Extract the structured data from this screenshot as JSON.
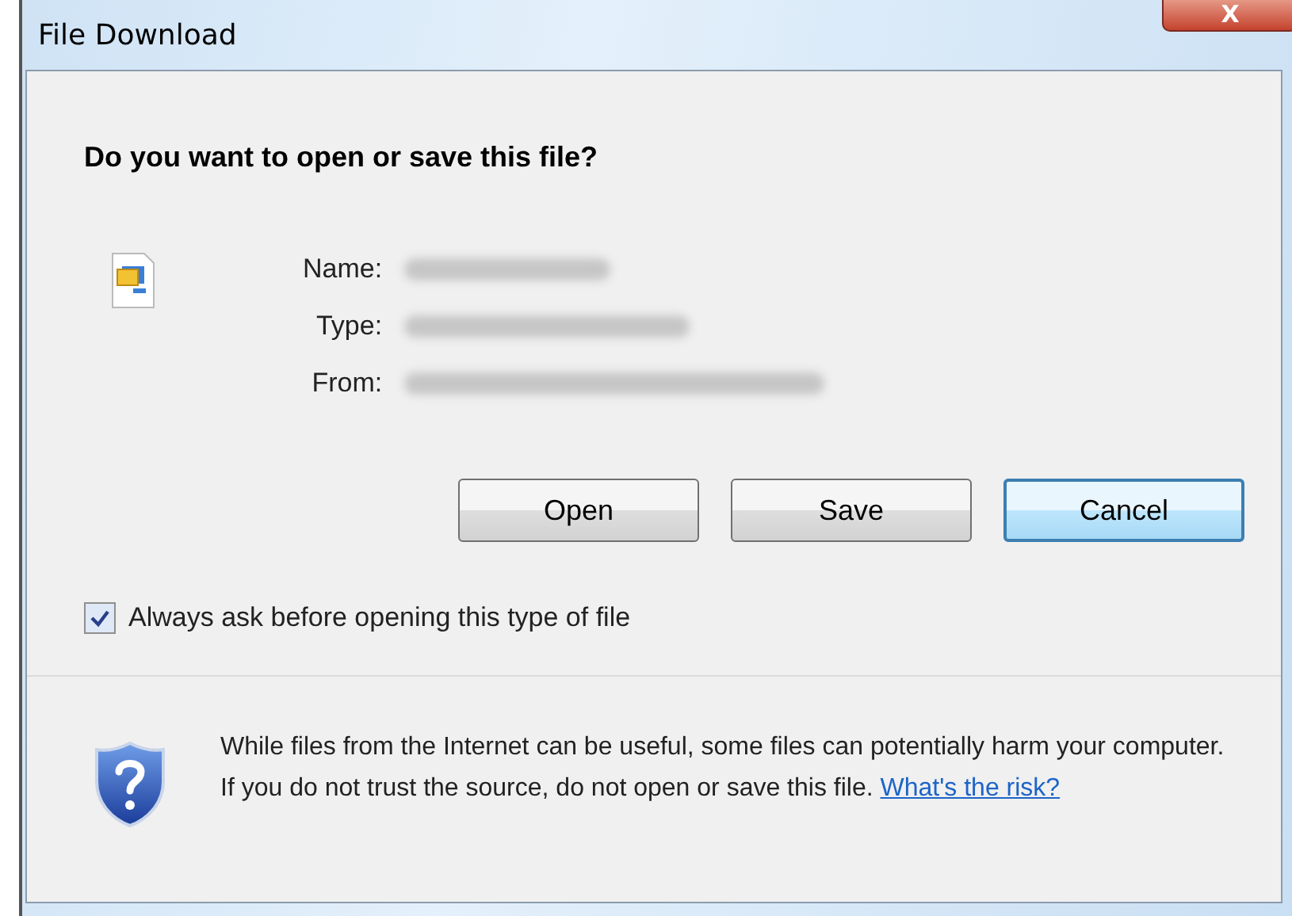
{
  "window": {
    "title": "File Download",
    "close_label": "X"
  },
  "heading": "Do you want to open or save this file?",
  "fields": [
    {
      "label": "Name:"
    },
    {
      "label": "Type:"
    },
    {
      "label": "From:"
    }
  ],
  "buttons": [
    {
      "label": "Open",
      "selected": false
    },
    {
      "label": "Save",
      "selected": false
    },
    {
      "label": "Cancel",
      "selected": true
    }
  ],
  "always_ask": {
    "label": "Always ask before opening this type of file",
    "checked": true
  },
  "warning": {
    "text": "While files from the Internet can be useful, some files can potentially harm your computer. If you do not trust the source, do not open or save this file.",
    "link": "What's the risk?"
  }
}
